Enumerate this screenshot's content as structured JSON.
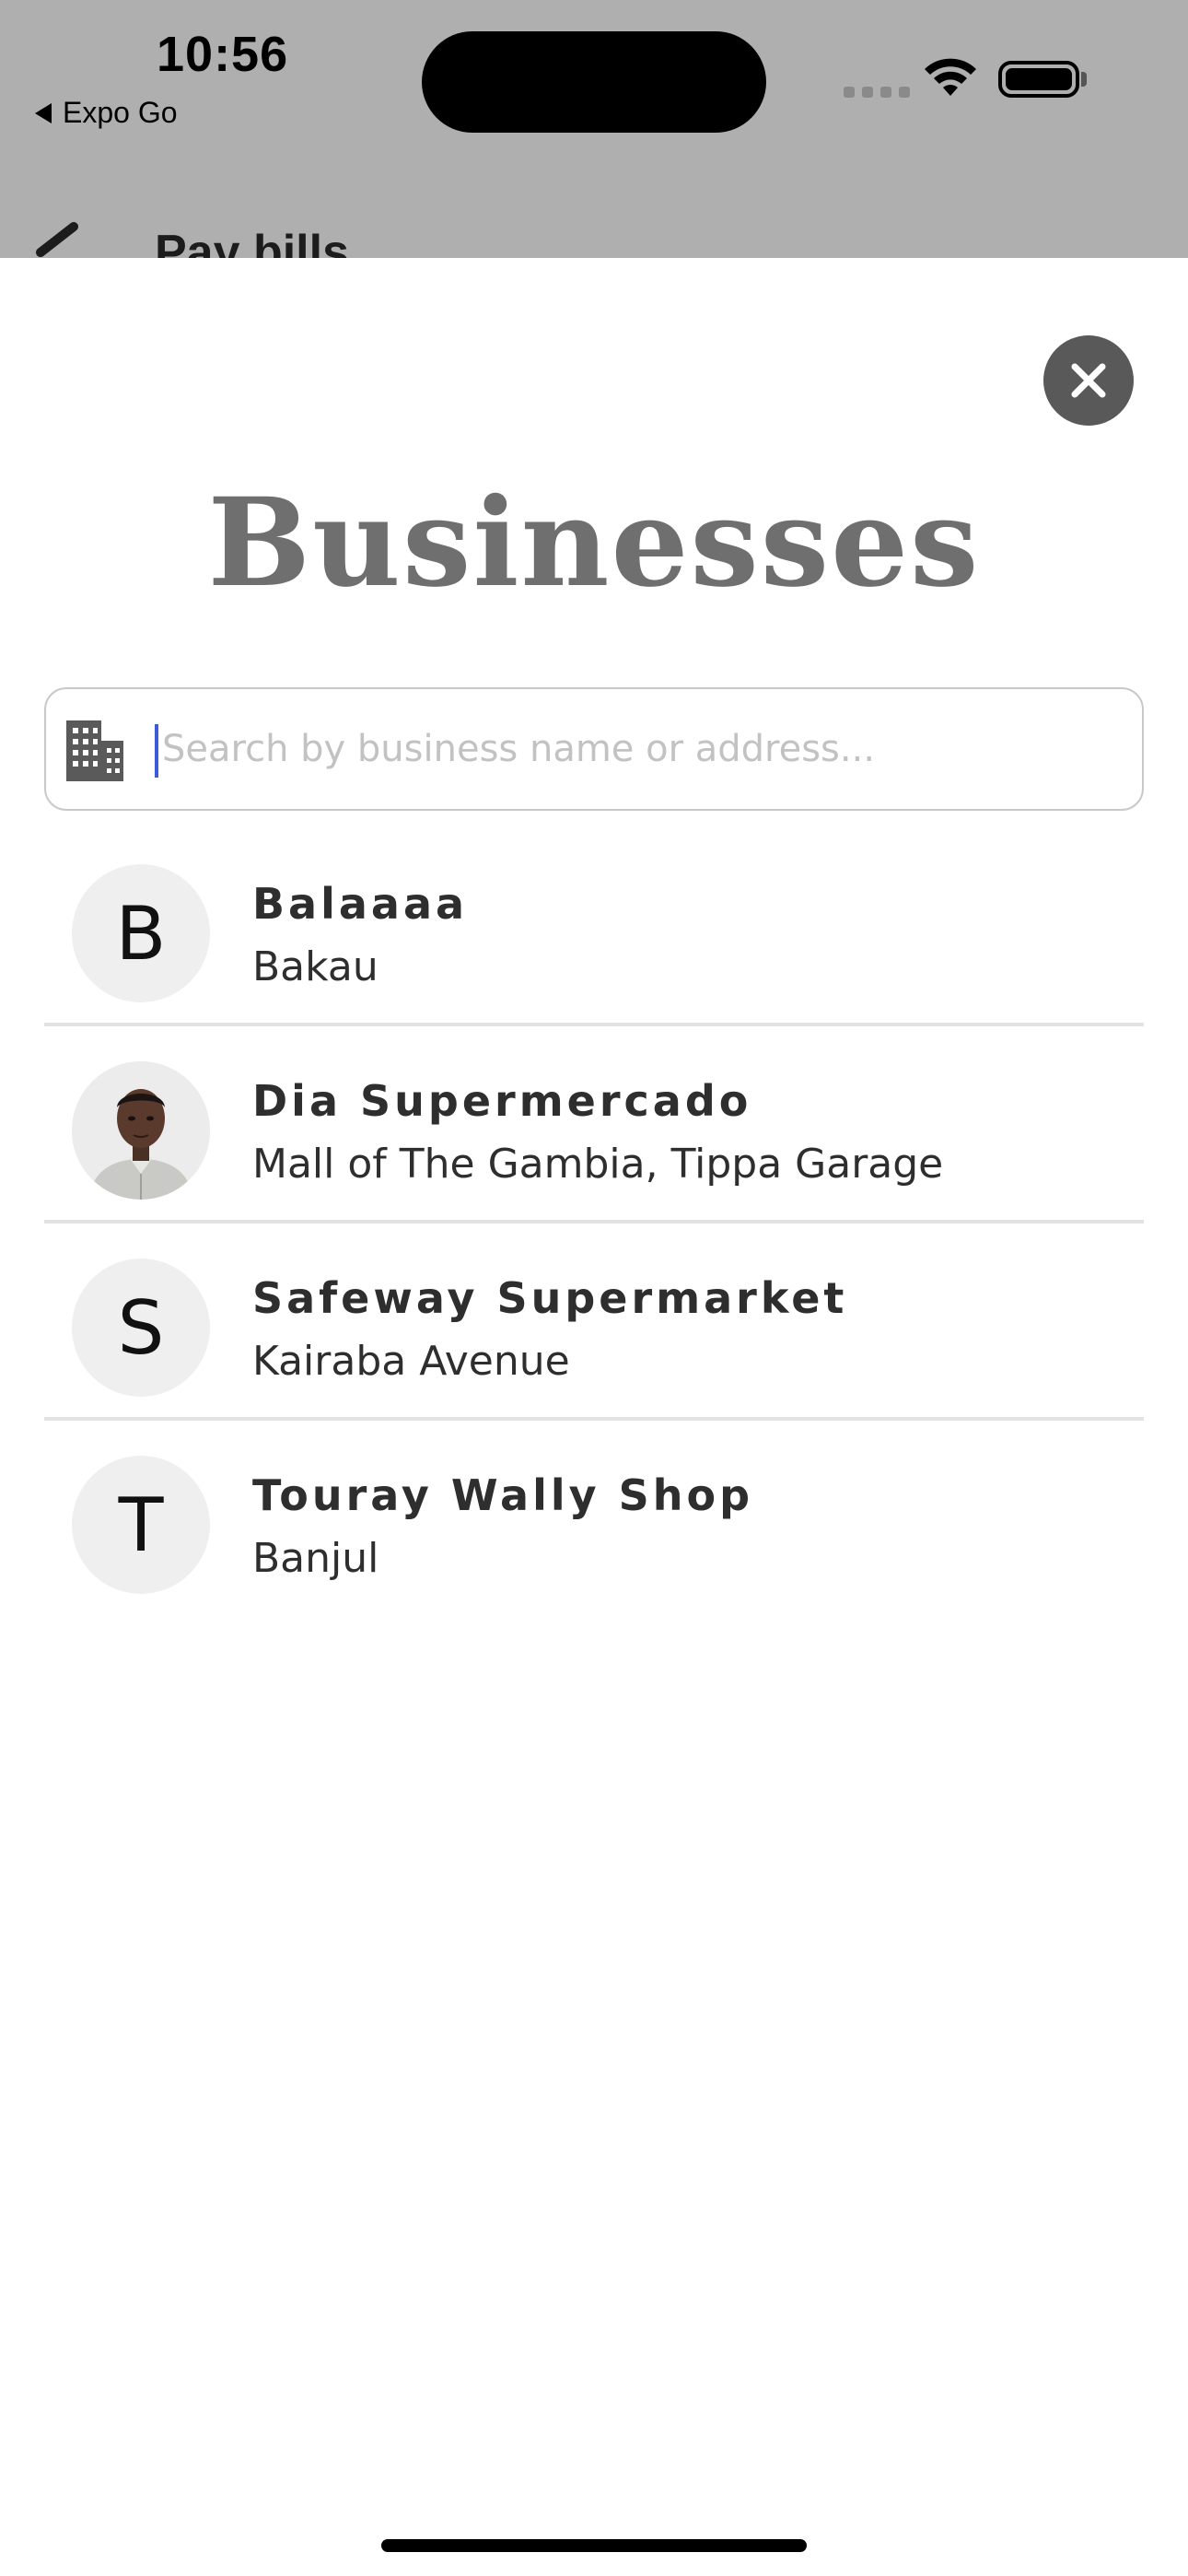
{
  "status_bar": {
    "time": "10:56",
    "back_app_label": "Expo Go"
  },
  "underlying_screen": {
    "title": "Pay bills"
  },
  "modal": {
    "title": "Businesses",
    "search": {
      "placeholder": "Search by business name or address...",
      "value": ""
    },
    "businesses": [
      {
        "initial": "B",
        "name": "Balaaaa",
        "address": "Bakau",
        "has_photo": false
      },
      {
        "initial": "",
        "name": "Dia Supermercado",
        "address": "Mall of The Gambia, Tippa Garage",
        "has_photo": true
      },
      {
        "initial": "S",
        "name": "Safeway Supermarket",
        "address": "Kairaba Avenue",
        "has_photo": false
      },
      {
        "initial": "T",
        "name": "Touray Wally Shop",
        "address": "Banjul",
        "has_photo": false
      }
    ]
  },
  "colors": {
    "backdrop": "#afafaf",
    "close_button": "#595959",
    "title": "#6f6f6f",
    "caret": "#3b5bdb",
    "divider": "#e2e2e2",
    "avatar_bg": "#efefef"
  },
  "icons": {
    "close": "close-icon",
    "search": "building-icon",
    "back": "chevron-left-icon"
  }
}
